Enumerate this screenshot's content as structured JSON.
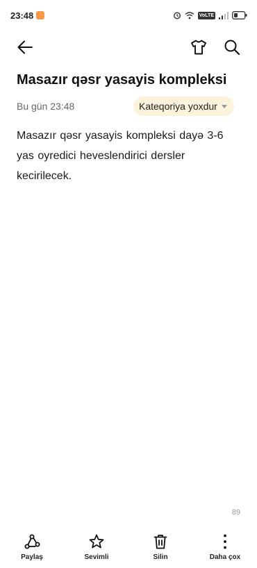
{
  "status_bar": {
    "time": "23:48",
    "volte": "VoLTE"
  },
  "note": {
    "title": "Masazır qəsr yasayis kompleksi",
    "date": "Bu gün 23:48",
    "category": "Kateqoriya yoxdur",
    "body": "Masazır qəsr yasayis kompleksi dayə 3-6 yas oyredici heveslendirici dersler kecirilecek.",
    "char_count": "89"
  },
  "actions": {
    "share": "Paylaş",
    "favorite": "Sevimli",
    "delete": "Silin",
    "more": "Daha çox"
  },
  "colors": {
    "chip_bg": "#fdf3dd",
    "text": "#111111",
    "secondary_text": "#666666"
  }
}
